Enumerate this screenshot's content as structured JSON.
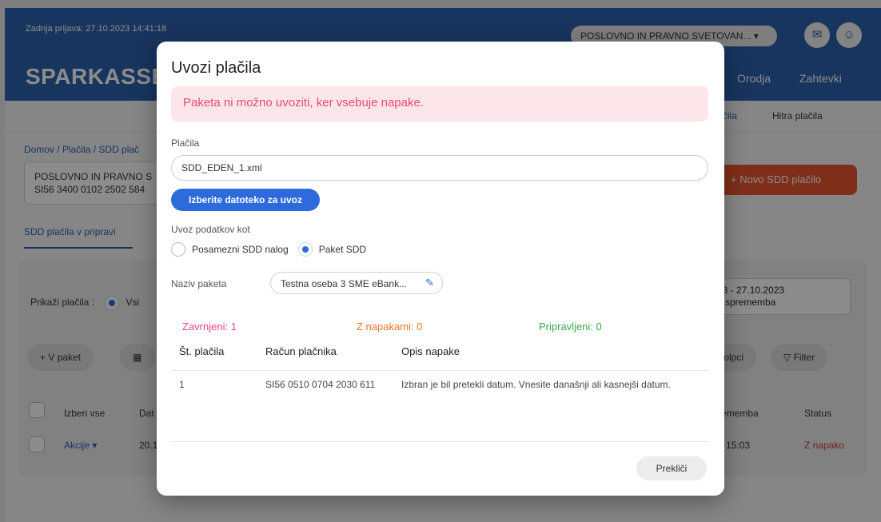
{
  "app": {
    "last_login": "Zadnja prijava: 27.10.2023 14:41:18",
    "brand": "SPARKASSE",
    "company_select": "POSLOVNO IN PRAVNO SVETOVAN... ▾",
    "nav": [
      "Orodja",
      "Zahtevki"
    ],
    "subnav": [
      "čila",
      "Hitra plačila"
    ],
    "breadcrumb": "Domov  /  Plačila  /  SDD plač",
    "account_name": "POSLOVNO IN PRAVNO S",
    "account_iban": "SI56 3400 0102 2502 584",
    "new_button": "+  Novo SDD plačilo",
    "tab_active": "SDD plačila v pripravi",
    "show_label": "Prikaži plačila :",
    "show_value": "Vsi",
    "date_range": "23 - 27.10.2023",
    "date_sub": "a sprememba",
    "pill_package": "+  V paket",
    "pill_columns": "tolpci",
    "pill_filter": "Filter",
    "col_select_all": "Izberi vse",
    "col_date": "Dat",
    "col_change": "rememba",
    "col_status": "Status",
    "row_actions": "Akcije",
    "row_date": "20.1",
    "row_time": "3 15:03",
    "row_status": "Z napako"
  },
  "modal": {
    "title": "Uvozi plačila",
    "alert": "Paketa ni možno uvoziti, ker vsebuje napake.",
    "payments_label": "Plačila",
    "file_value": "SDD_EDEN_1.xml",
    "choose_button": "Izberite datoteko za uvoz",
    "import_as_label": "Uvoz podatkov kot",
    "radio_single": "Posamezni SDD nalog",
    "radio_package": "Paket SDD",
    "package_name_label": "Naziv paketa",
    "package_name_value": "Testna oseba 3 SME eBank...",
    "stat_done": "Zavrnjeni: 1",
    "stat_errors": "Z napakami: 0",
    "stat_ready": "Pripravljeni: 0",
    "columns": [
      "Št. plačila",
      "Račun plačnika",
      "Opis napake"
    ],
    "rows": [
      [
        "1",
        "SI56 0510 0704 2030 611",
        "Izbran je bil pretekli datum. Vnesite današnji ali kasnejši datum."
      ]
    ],
    "cancel_button": "Prekliči"
  },
  "colors": {
    "brand_blue": "#2c61ad",
    "accent_blue": "#2d6bdc",
    "alert_text": "#e4497c",
    "stat_done": "#e4497c",
    "stat_errors": "#e8762e",
    "stat_ready": "#3aa84a"
  }
}
